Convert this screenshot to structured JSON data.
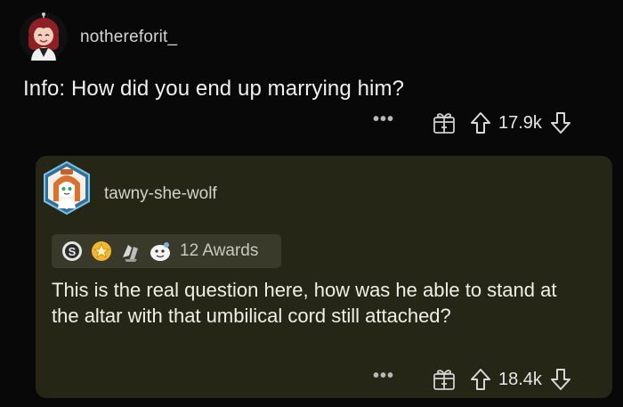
{
  "top_comment": {
    "username": "nothereforit_",
    "body": "Info: How did you end up marrying him?",
    "score": "17.9k",
    "more_label": "•••"
  },
  "reply": {
    "username": "tawny-she-wolf",
    "awards_label": "12 Awards",
    "body": "This is the real question here, how was he able to stand at the altar with that umbilical cord still attached?",
    "score": "18.4k",
    "more_label": "•••"
  },
  "icons": {
    "top_avatar": "avatar-red-hair-icon",
    "reply_avatar": "avatar-snoo-icon",
    "more": "more-options-icon",
    "gift": "gift-award-icon",
    "upvote": "upvote-arrow-icon",
    "downvote": "downvote-arrow-icon",
    "awards": [
      "silver-award-icon",
      "gold-award-icon",
      "hands-award-icon",
      "wholesome-award-icon"
    ]
  },
  "colors": {
    "background": "#080808",
    "card": "#262616",
    "awards_bg": "#3a3a2a",
    "text": "#e8e8e8"
  }
}
